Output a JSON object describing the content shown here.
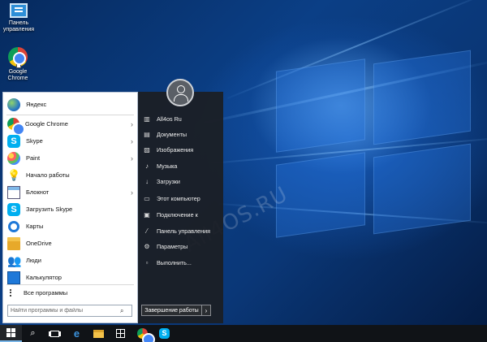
{
  "desktop": {
    "icons": [
      {
        "label": "Панель управления",
        "icon": "control-panel-icon"
      },
      {
        "label": "Google Chrome",
        "icon": "chrome-icon"
      }
    ],
    "watermark": "All4OS.RU",
    "colors": {
      "accent": "#0b3f86",
      "taskbar": "#101317",
      "start_right": "#1c1f24"
    }
  },
  "start_menu": {
    "programs": [
      {
        "label": "Яндекс",
        "icon": "yandex-globe-icon",
        "submenu": false
      },
      {
        "label": "Google Chrome",
        "icon": "chrome-icon",
        "submenu": true
      },
      {
        "label": "Skype",
        "icon": "skype-icon",
        "submenu": true
      },
      {
        "label": "Paint",
        "icon": "paint-icon",
        "submenu": true
      },
      {
        "label": "Начало работы",
        "icon": "lightbulb-icon",
        "submenu": false
      },
      {
        "label": "Блокнот",
        "icon": "notepad-icon",
        "submenu": true
      },
      {
        "label": "Загрузить Skype",
        "icon": "skype-icon",
        "submenu": false
      },
      {
        "label": "Карты",
        "icon": "maps-icon",
        "submenu": false
      },
      {
        "label": "OneDrive",
        "icon": "onedrive-icon",
        "submenu": false
      },
      {
        "label": "Люди",
        "icon": "people-icon",
        "submenu": false
      },
      {
        "label": "Калькулятор",
        "icon": "calculator-icon",
        "submenu": false
      }
    ],
    "all_programs": "Все программы",
    "search_placeholder": "Найти программы и файлы",
    "right_items": [
      {
        "label": "All4os Ru",
        "icon": "user-folder-icon"
      },
      {
        "label": "Документы",
        "icon": "documents-icon"
      },
      {
        "label": "Изображения",
        "icon": "pictures-icon"
      },
      {
        "label": "Музыка",
        "icon": "music-icon"
      },
      {
        "label": "Загрузки",
        "icon": "downloads-icon"
      },
      {
        "label": "Этот компьютер",
        "icon": "computer-icon"
      },
      {
        "label": "Подключение к",
        "icon": "connect-icon"
      },
      {
        "label": "Панель управления",
        "icon": "control-panel-icon"
      },
      {
        "label": "Параметры",
        "icon": "settings-icon"
      },
      {
        "label": "Выполнить...",
        "icon": "run-icon"
      }
    ],
    "shutdown": "Завершение работы"
  },
  "taskbar": {
    "items": [
      "start-icon",
      "search-icon",
      "task-view-icon",
      "edge-icon",
      "file-explorer-icon",
      "store-icon",
      "chrome-icon",
      "skype-icon"
    ]
  }
}
